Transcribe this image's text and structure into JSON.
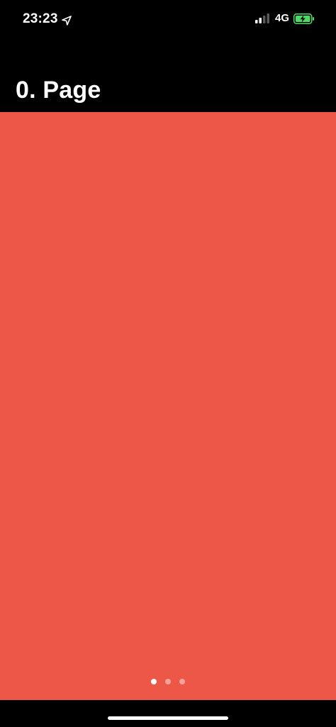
{
  "status_bar": {
    "time": "23:23",
    "network": "4G",
    "battery_color": "#4cd964"
  },
  "header": {
    "title": "0. Page"
  },
  "page": {
    "background_color": "#ed5748",
    "current_page_index": 0,
    "page_count": 3
  },
  "colors": {
    "background": "#000000",
    "page_red": "#ed5748",
    "text": "#ffffff"
  }
}
